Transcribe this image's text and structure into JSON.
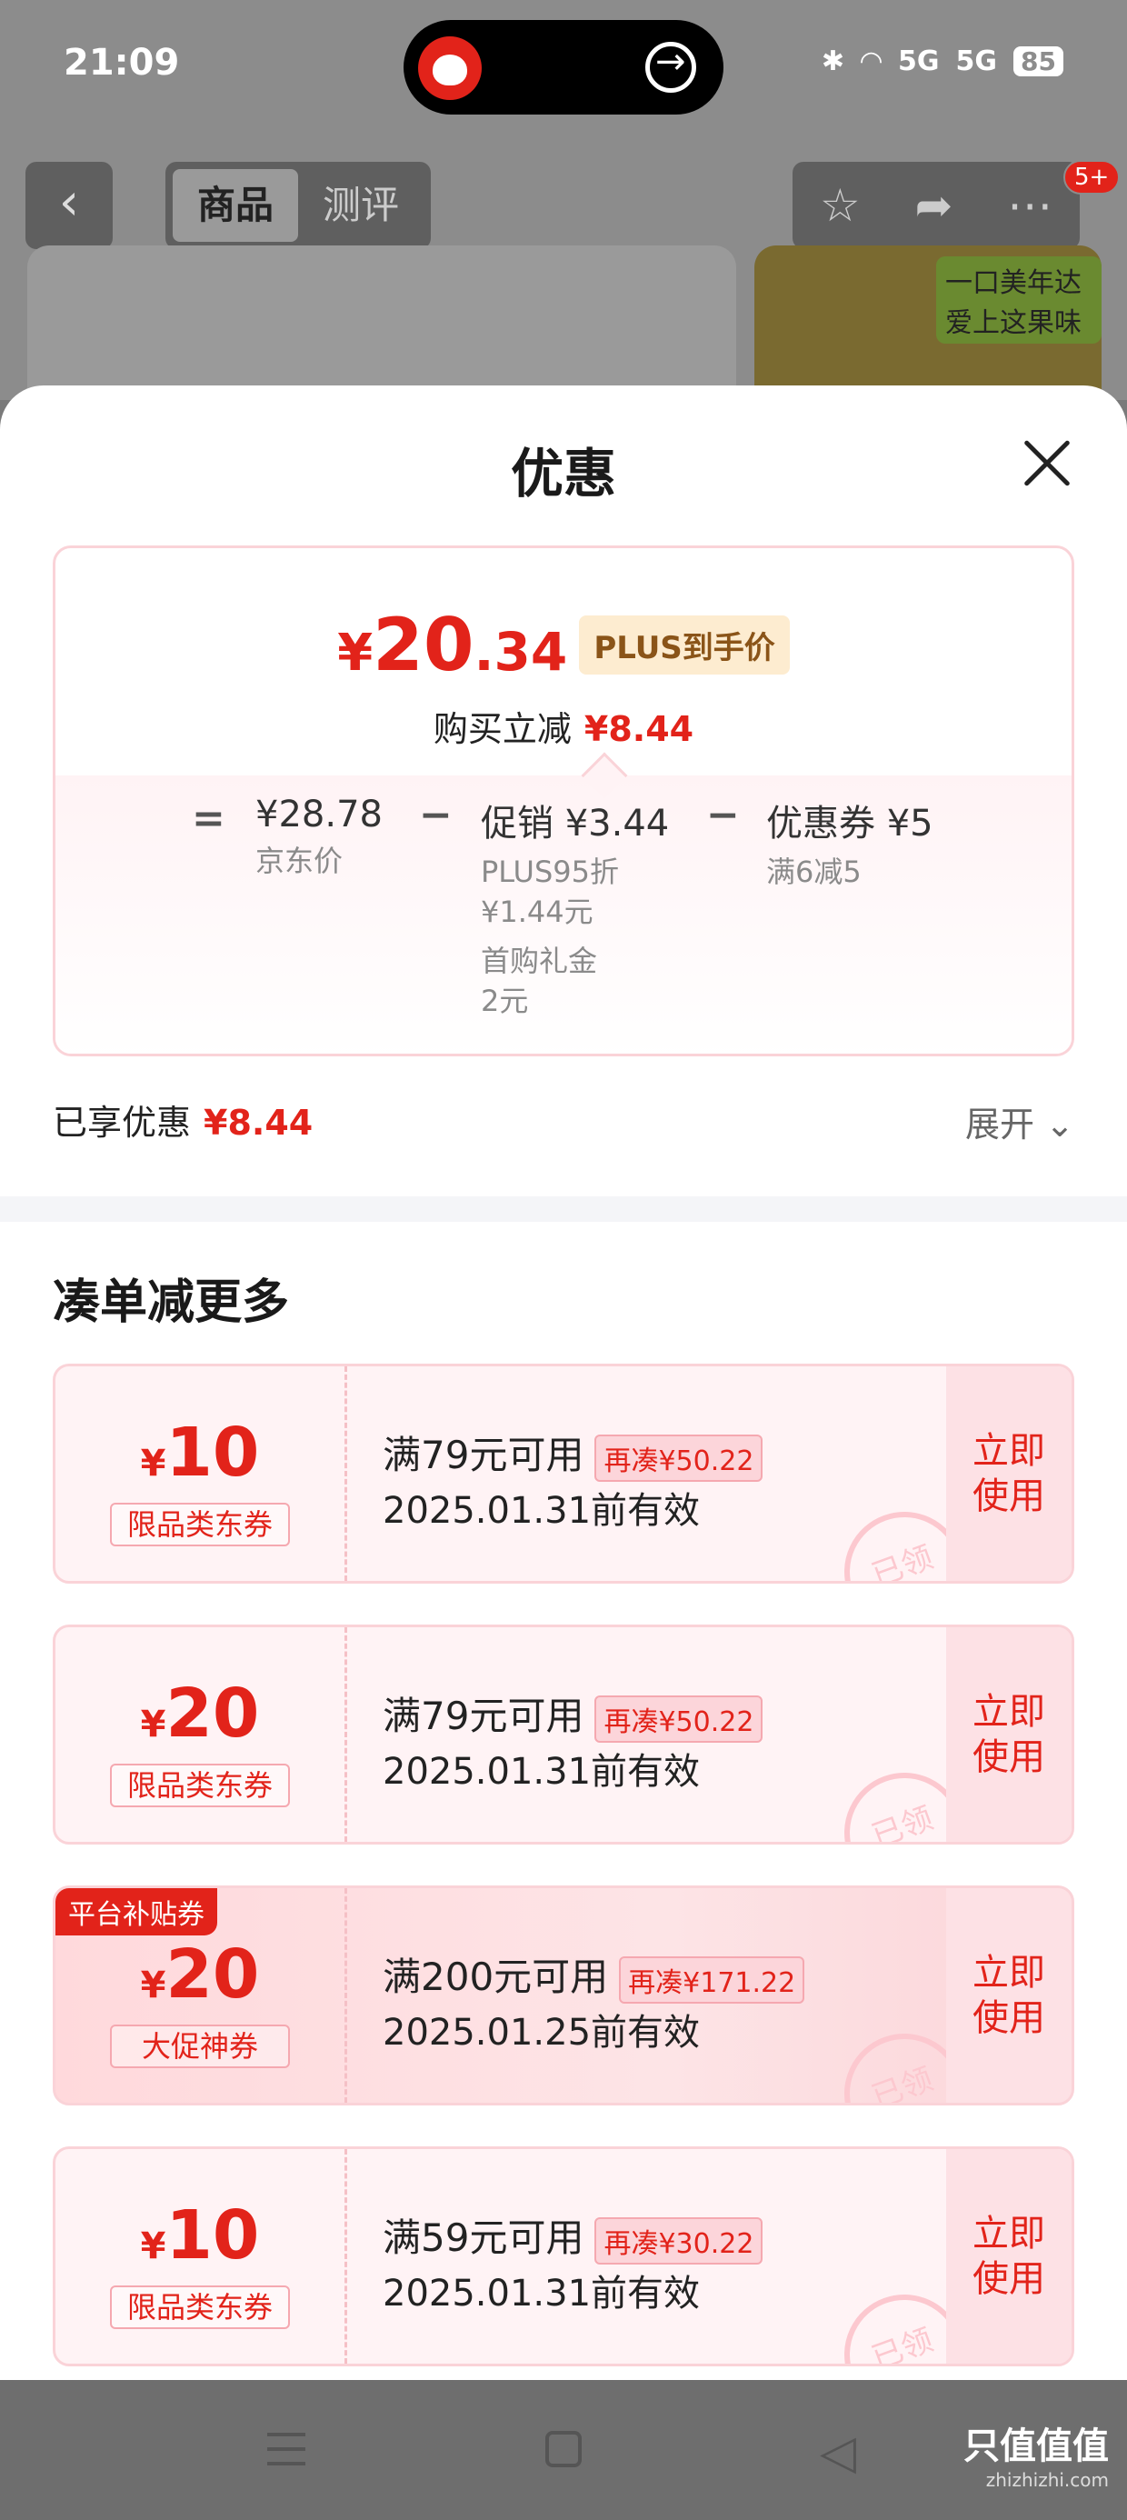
{
  "status_bar": {
    "time": "21:09",
    "network": "5G",
    "network2": "5G",
    "battery": "85"
  },
  "top_nav": {
    "tabs": [
      "商品",
      "测评"
    ],
    "active_tab": 0,
    "badge": "5+",
    "ad_text": "一口美年达 爱上这果味"
  },
  "sheet": {
    "title": "优惠",
    "price": {
      "yen": "¥",
      "int": "20",
      "dec": ".34",
      "tag": "PLUS到手价"
    },
    "reduce": {
      "label": "购买立减",
      "value": "¥8.44"
    },
    "breakdown": {
      "eq": "=",
      "minus": "−",
      "jd_price": {
        "value": "¥28.78",
        "label": "京东价"
      },
      "promo": {
        "value": "促销 ¥3.44",
        "line1": "PLUS95折",
        "line2": "¥1.44元",
        "line3": "首购礼金",
        "line4": "2元"
      },
      "coupon": {
        "value": "优惠券 ¥5",
        "label": "满6减5"
      }
    },
    "enjoyed": {
      "label": "已享优惠",
      "value": "¥8.44"
    },
    "expand": "展开",
    "section_title": "凑单减更多",
    "coupons": [
      {
        "yen": "¥",
        "amount": "10",
        "type": "限品类东券",
        "cond": "满79元可用",
        "gap": "再凑¥50.22",
        "date": "2025.01.31前有效",
        "use1": "立即",
        "use2": "使用",
        "stamp": "已领"
      },
      {
        "yen": "¥",
        "amount": "20",
        "type": "限品类东券",
        "cond": "满79元可用",
        "gap": "再凑¥50.22",
        "date": "2025.01.31前有效",
        "use1": "立即",
        "use2": "使用",
        "stamp": "已领"
      },
      {
        "yen": "¥",
        "amount": "20",
        "type": "大促神券",
        "cond": "满200元可用",
        "gap": "再凑¥171.22",
        "date": "2025.01.25前有效",
        "use1": "立即",
        "use2": "使用",
        "stamp": "已领",
        "tag": "平台补贴券"
      },
      {
        "yen": "¥",
        "amount": "10",
        "type": "限品类东券",
        "cond": "满59元可用",
        "gap": "再凑¥30.22",
        "date": "2025.01.31前有效",
        "use1": "立即",
        "use2": "使用",
        "stamp": "已领"
      }
    ]
  },
  "watermark": {
    "line1": "只值值值",
    "line2": "zhizhizhi.com"
  },
  "colors": {
    "accent": "#e2231a",
    "plus_tag_bg": "#fdecd0",
    "coupon_bg": "#fff3f5"
  }
}
